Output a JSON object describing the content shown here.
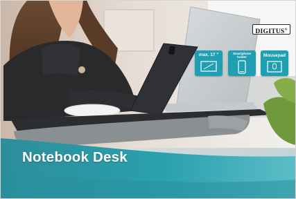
{
  "brand": {
    "logo_text": "DIGITUS",
    "registered_mark": "®"
  },
  "headline": "Notebook Desk",
  "features": [
    {
      "label": "max. 17 \"",
      "icon": "laptop-screen-icon"
    },
    {
      "label_line1": "Smartphone",
      "label_line2": "holder",
      "icon": "smartphone-icon"
    },
    {
      "label": "Mousepad",
      "icon": "mouse-icon"
    }
  ],
  "colors": {
    "accent_teal": "#1f9fb1",
    "headline_band": "#2a9aa8",
    "cushion_grey": "#8a8f92",
    "tray_dark": "#2b2d30"
  }
}
